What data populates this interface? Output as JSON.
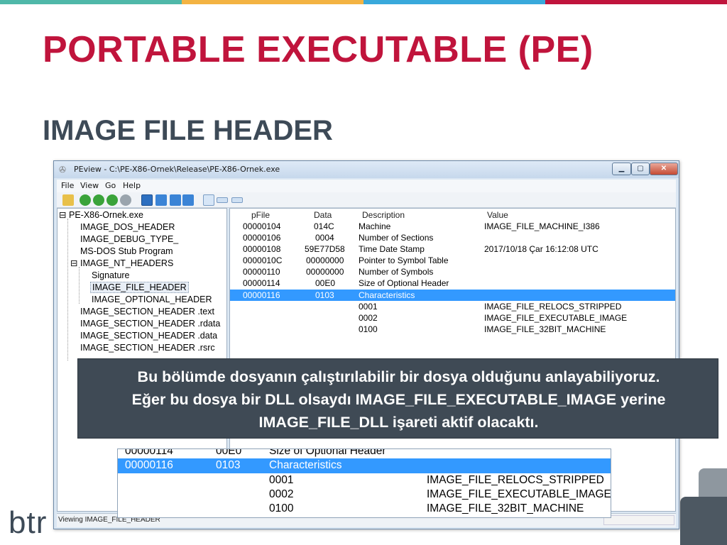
{
  "slide": {
    "title": "PORTABLE EXECUTABLE (PE)",
    "subtitle": "IMAGE FILE HEADER",
    "stripe_colors": [
      "#4fb8a9",
      "#f3b343",
      "#39a9db",
      "#c0143c"
    ]
  },
  "window": {
    "title": "PEview - C:\\PE-X86-Ornek\\Release\\PE-X86-Ornek.exe",
    "menu": [
      "File",
      "View",
      "Go",
      "Help"
    ],
    "status": "Viewing IMAGE_FILE_HEADER"
  },
  "tree": {
    "items": [
      "PE-X86-Ornek.exe",
      "IMAGE_DOS_HEADER",
      "IMAGE_DEBUG_TYPE_",
      "MS-DOS Stub Program",
      "IMAGE_NT_HEADERS",
      "Signature",
      "IMAGE_FILE_HEADER",
      "IMAGE_OPTIONAL_HEADER",
      "IMAGE_SECTION_HEADER .text",
      "IMAGE_SECTION_HEADER .rdata",
      "IMAGE_SECTION_HEADER .data",
      "IMAGE_SECTION_HEADER .rsrc"
    ]
  },
  "list": {
    "headers": [
      "pFile",
      "Data",
      "Description",
      "Value"
    ],
    "rows": [
      [
        "00000104",
        "014C",
        "Machine",
        "IMAGE_FILE_MACHINE_I386"
      ],
      [
        "00000106",
        "0004",
        "Number of Sections",
        ""
      ],
      [
        "00000108",
        "59E77D58",
        "Time Date Stamp",
        "2017/10/18 Çar 16:12:08 UTC"
      ],
      [
        "0000010C",
        "00000000",
        "Pointer to Symbol Table",
        ""
      ],
      [
        "00000110",
        "00000000",
        "Number of Symbols",
        ""
      ],
      [
        "00000114",
        "00E0",
        "Size of Optional Header",
        ""
      ],
      [
        "00000116",
        "0103",
        "Characteristics",
        ""
      ],
      [
        "",
        "",
        "0001",
        "IMAGE_FILE_RELOCS_STRIPPED"
      ],
      [
        "",
        "",
        "0002",
        "IMAGE_FILE_EXECUTABLE_IMAGE"
      ],
      [
        "",
        "",
        "0100",
        "IMAGE_FILE_32BIT_MACHINE"
      ]
    ]
  },
  "callout": {
    "line1": "Bu bölümde dosyanın çalıştırılabilir bir dosya olduğunu anlayabiliyoruz.",
    "line2": "Eğer bu dosya bir DLL olsaydı IMAGE_FILE_EXECUTABLE_IMAGE yerine",
    "line3": "IMAGE_FILE_DLL işareti aktif olacaktı."
  },
  "zoom": {
    "row0": [
      "00000114",
      "00E0",
      "Size of Optional Header"
    ],
    "row1": [
      "00000116",
      "0103",
      "Characteristics"
    ],
    "row2": [
      "0001",
      "IMAGE_FILE_RELOCS_STRIPPED"
    ],
    "row3": [
      "0002",
      "IMAGE_FILE_EXECUTABLE_IMAGE"
    ],
    "row4": [
      "0100",
      "IMAGE_FILE_32BIT_MACHINE"
    ]
  },
  "logo": {
    "text": "btr"
  }
}
